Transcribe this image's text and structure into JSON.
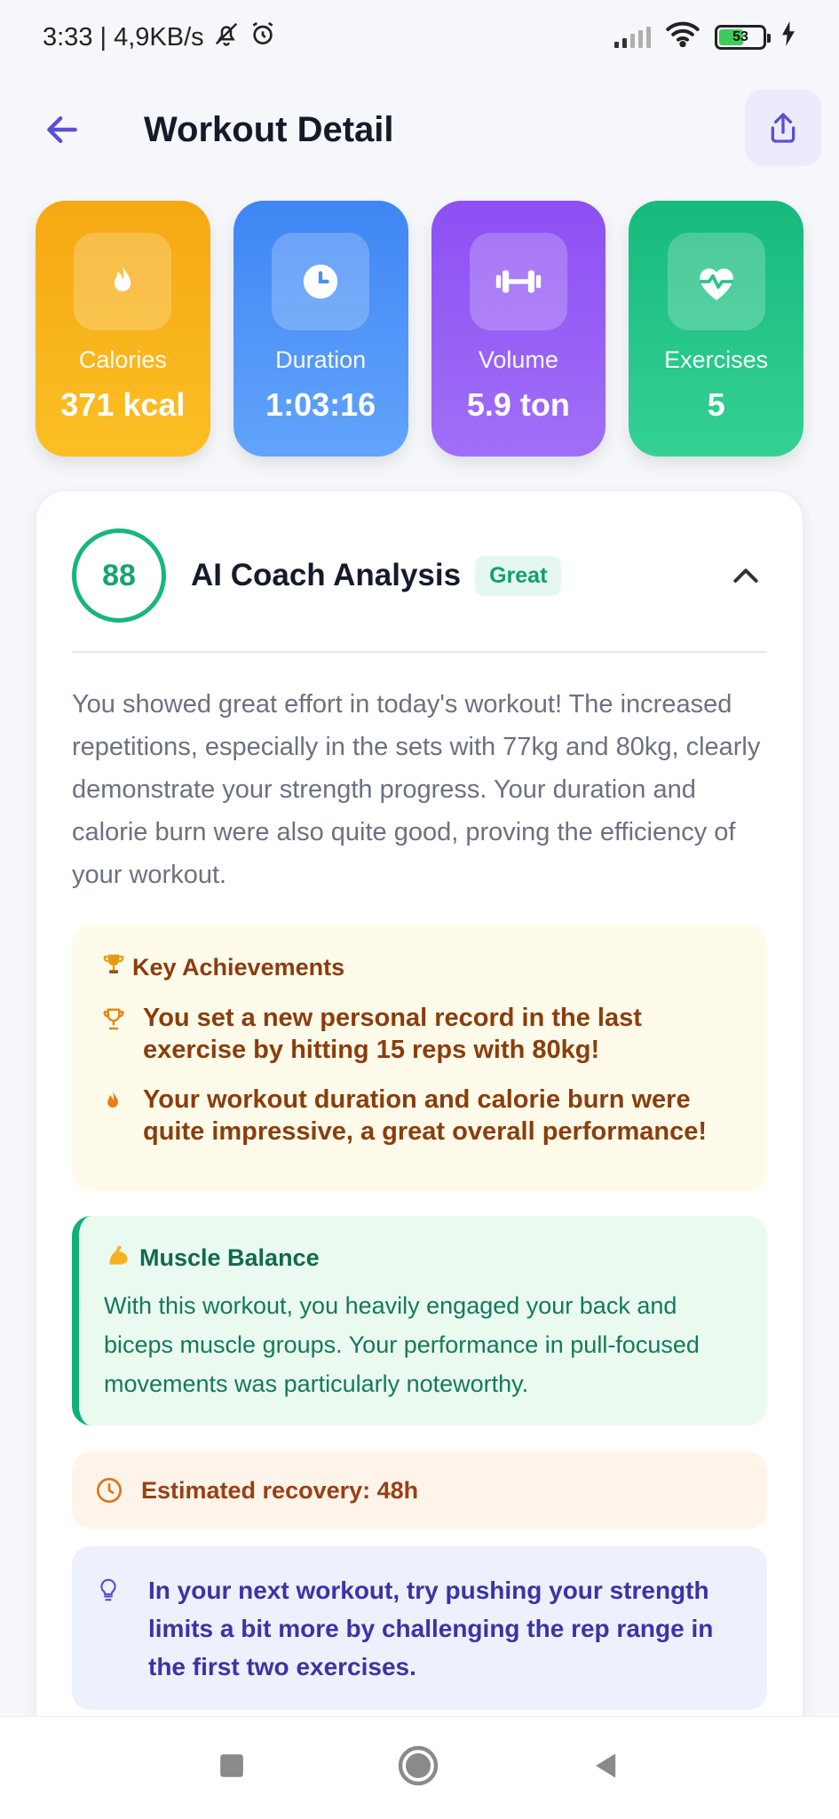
{
  "status_bar": {
    "time_speed": "3:33 | 4,9KB/s",
    "battery": "53"
  },
  "header": {
    "title": "Workout Detail"
  },
  "stats": [
    {
      "label": "Calories",
      "value": "371 kcal",
      "icon": "flame-icon"
    },
    {
      "label": "Duration",
      "value": "1:03:16",
      "icon": "clock-icon"
    },
    {
      "label": "Volume",
      "value": "5.9 ton",
      "icon": "dumbbell-icon"
    },
    {
      "label": "Exercises",
      "value": "5",
      "icon": "heartbeat-icon"
    }
  ],
  "coach": {
    "score": "88",
    "title": "AI Coach Analysis",
    "badge": "Great",
    "summary": "You showed great effort in today's workout! The increased repetitions, especially in the sets with 77kg and 80kg, clearly demonstrate your strength progress. Your duration and calorie burn were also quite good, proving the efficiency of your workout.",
    "achievements": {
      "title": "Key Achievements",
      "items": [
        "You set a new personal record in the last exercise by hitting 15 reps with 80kg!",
        "Your workout duration and calorie burn were quite impressive, a great overall performance!"
      ]
    },
    "muscle_balance": {
      "title": "Muscle Balance",
      "text": "With this workout, you heavily engaged your back and biceps muscle groups. Your performance in pull-focused movements was particularly noteworthy."
    },
    "recovery": "Estimated recovery: 48h",
    "tip": "In your next workout, try pushing your strength limits a bit more by challenging the rep range in the first two exercises."
  },
  "colors": {
    "accent": "#5b4fd6",
    "calories": "#f6a813",
    "duration": "#3f86f4",
    "volume": "#8e4ff3",
    "exercises": "#17b97e",
    "score_ring": "#16b67c"
  }
}
